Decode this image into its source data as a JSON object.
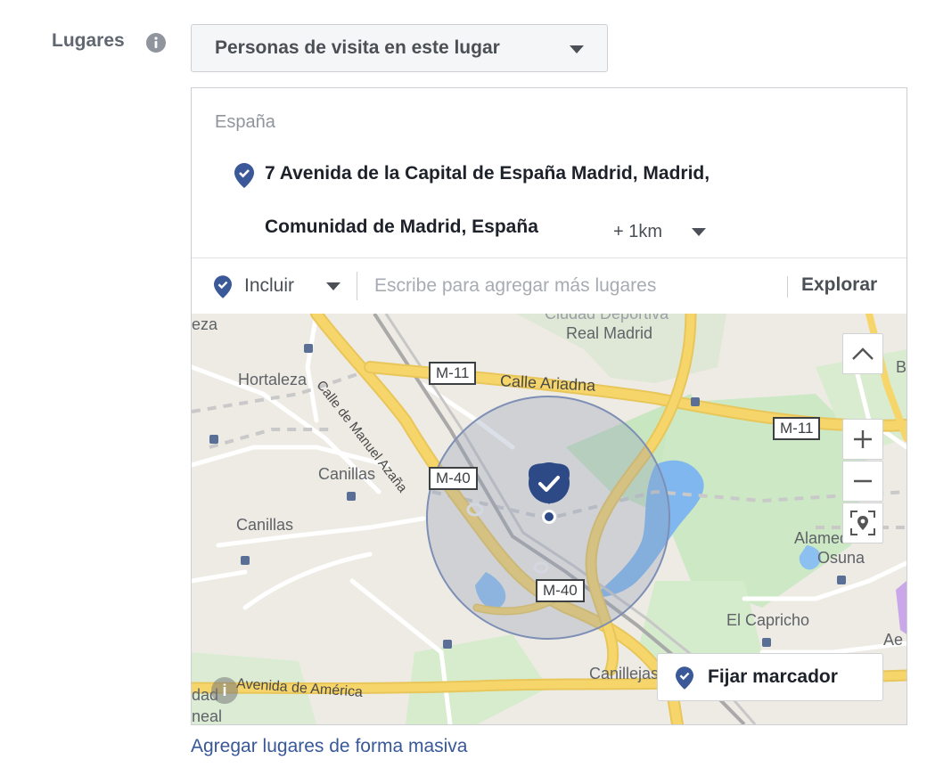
{
  "field": {
    "label": "Lugares",
    "info_icon": "info-icon"
  },
  "audience_select": {
    "value": "Personas de visita en este lugar",
    "icon": "caret-down-icon"
  },
  "selected": {
    "country": "España",
    "location_line1": "7 Avenida de la Capital de España Madrid, Madrid,",
    "location_line2": "Comunidad de Madrid, España",
    "radius": "+ 1km",
    "pin_icon": "location-check-pin-icon"
  },
  "add_row": {
    "include_label": "Incluir",
    "placeholder": "Escribe para agregar más lugares",
    "explore": "Explorar"
  },
  "map": {
    "labels": {
      "real_madrid": "Real Madrid",
      "hortaleza": "Hortaleza",
      "calle_manuel": "Calle de Manuel Azaña",
      "calle_ariadna": "Calle Ariadna",
      "canillas1": "Canillas",
      "canillas2": "Canillas",
      "alameda": "Alameda de",
      "osuna": "Osuna",
      "capricho": "El Capricho",
      "canillejas": "Canillejas",
      "avenida_america": "Avenida de América",
      "eza": "eza",
      "dad": "dad",
      "neal": "neal",
      "ae": "Ae",
      "b": "B",
      "ciudad": "Ciudad Deportiva"
    },
    "shields": {
      "m11_a": "M-11",
      "m11_b": "M-11",
      "m40_a": "M-40",
      "m40_b": "M-40"
    },
    "fix_marker": "Fijar marcador",
    "attribution": "i",
    "colors": {
      "water": "#7fb7ee",
      "park": "#c8e6c0",
      "highway": "#f6d56b",
      "radius_fill": "#8f9db6",
      "pin": "#2d4a86"
    }
  },
  "bulk_link": "Agregar lugares de forma masiva"
}
